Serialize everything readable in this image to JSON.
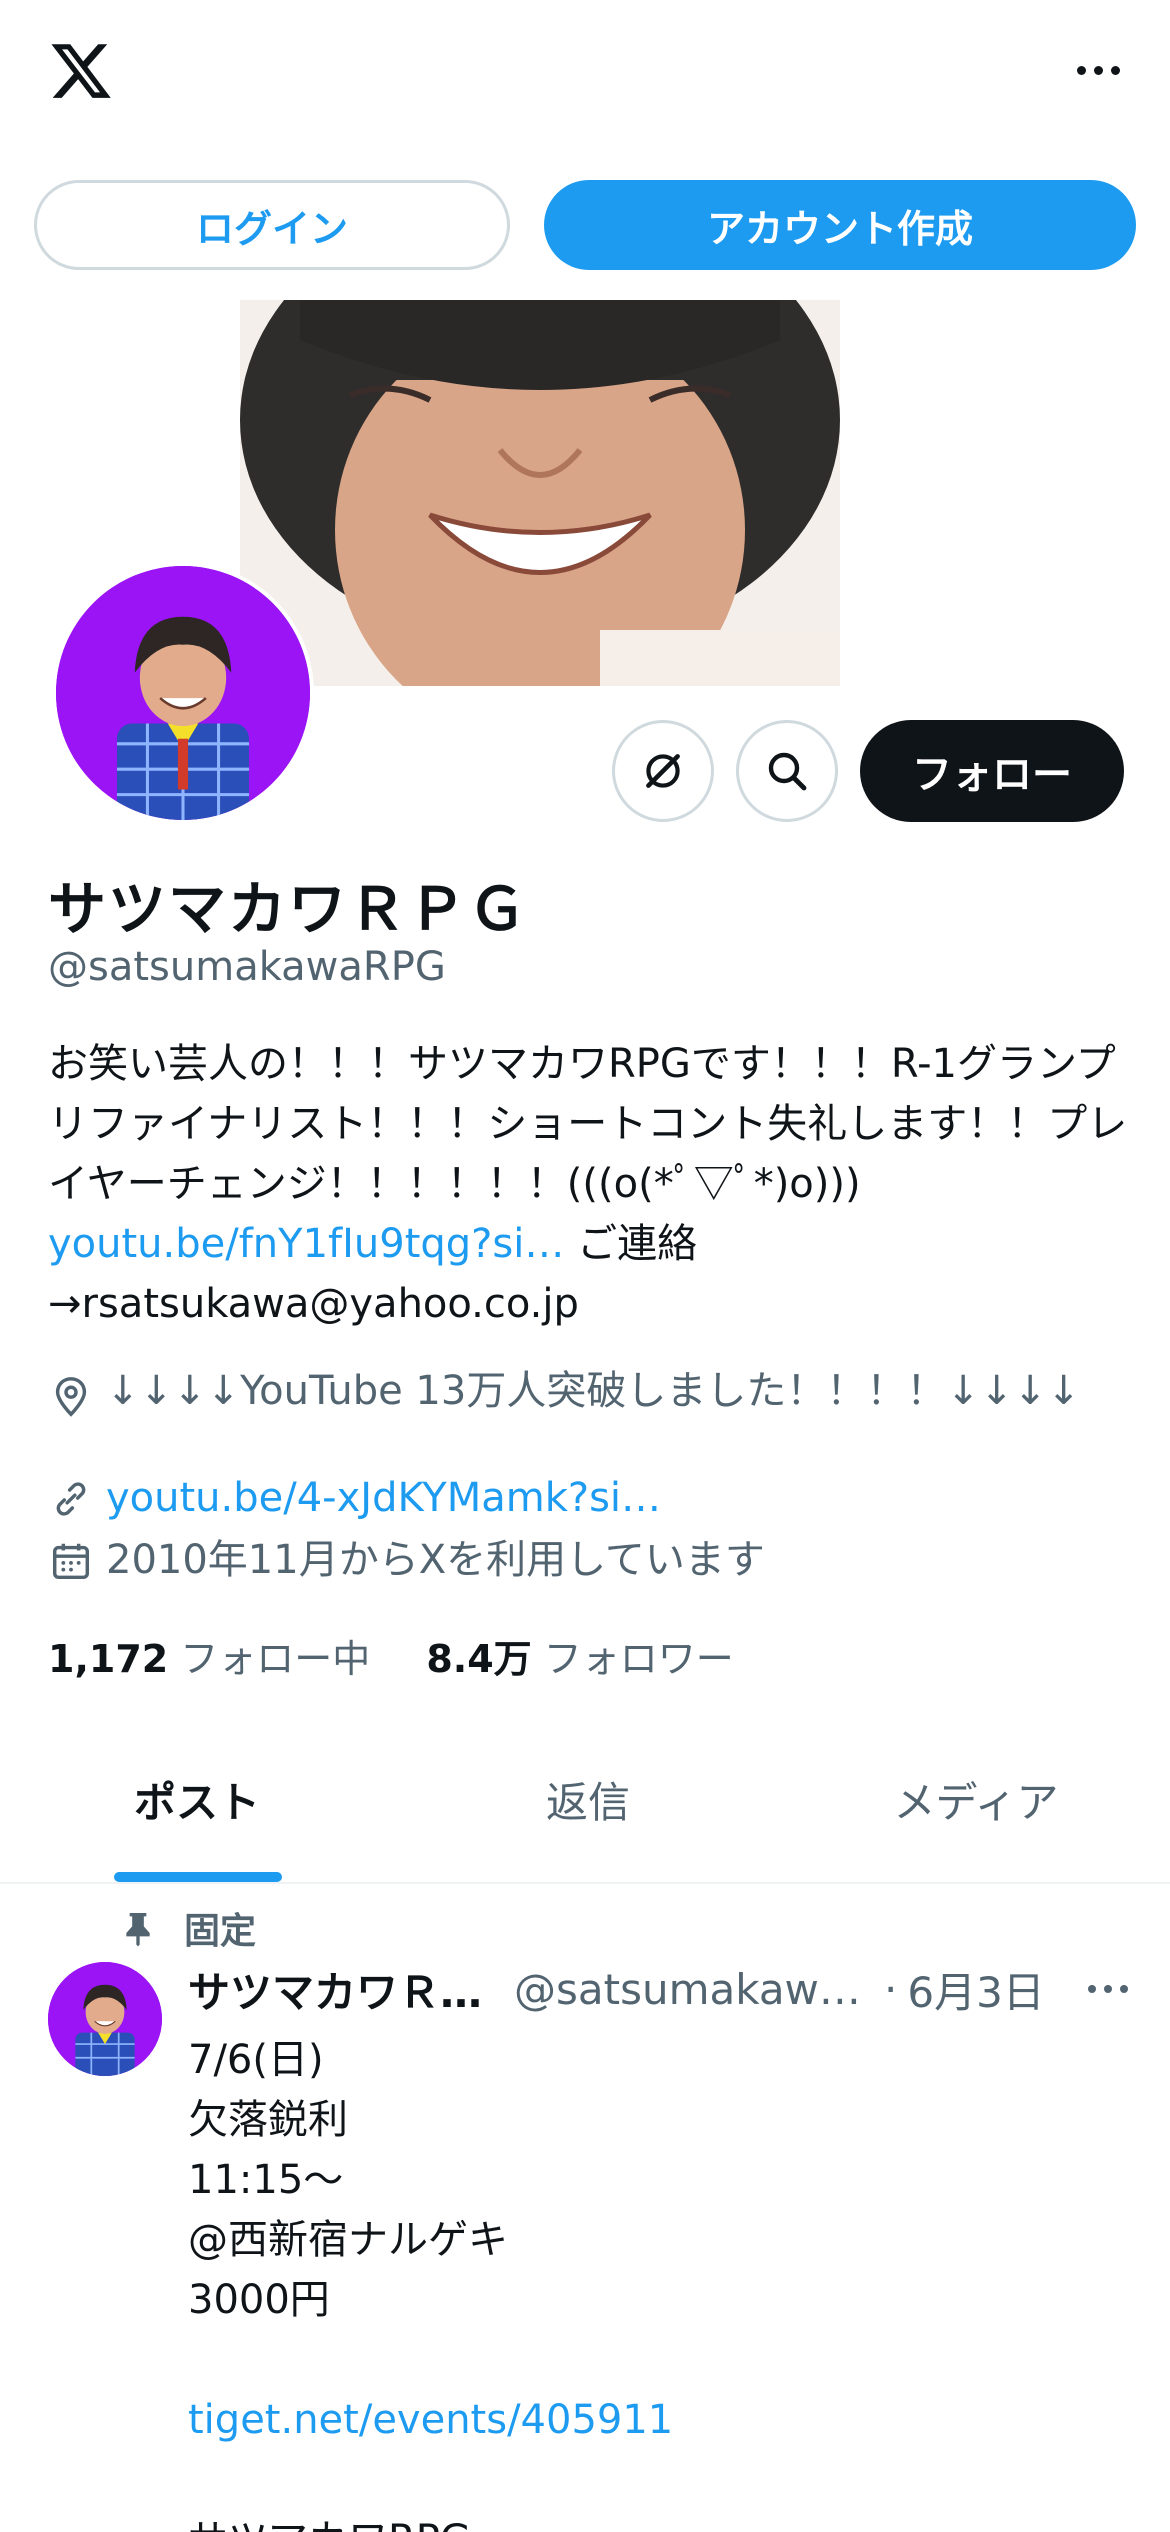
{
  "header": {
    "logo_icon": "x-logo-icon",
    "more_icon": "more-horizontal-icon"
  },
  "auth": {
    "login_label": "ログイン",
    "signup_label": "アカウント作成"
  },
  "profile": {
    "name": "サツマカワＲＰＧ",
    "handle": "@satsumakawaRPG",
    "bio_text": "お笑い芸人の！！！サツマカワRPGです！！！R-1グランプリファイナリスト！！！ショートコント失礼します！！プレイヤーチェンジ！！！！！！(((o(*ﾟ▽ﾟ*)o)))",
    "bio_link": "youtu.be/fnY1fIu9tqg?si…",
    "bio_contact_prefix": " ご連絡",
    "bio_contact": "→rsatsukawa@yahoo.co.jp",
    "location": "↓↓↓↓YouTube 13万人突破しました！！！！↓↓↓↓",
    "url": "youtu.be/4-xJdKYMamk?si…",
    "joined": "2010年11月からXを利用しています",
    "following_count": "1,172",
    "following_label": "フォロー中",
    "followers_count": "8.4万",
    "followers_label": "フォロワー",
    "follow_button": "フォロー",
    "accent_color": "#1d9bf0",
    "avatar_bg": "#9b14f5"
  },
  "tabs": [
    {
      "label": "ポスト",
      "active": true
    },
    {
      "label": "返信",
      "active": false
    },
    {
      "label": "メディア",
      "active": false
    }
  ],
  "post": {
    "pinned_label": "固定",
    "author_name": "サツマカワＲＰＧ",
    "author_handle": "@satsumakawaRPG",
    "date": "6月3日",
    "lines": [
      "7/6(日)",
      "欠落鋭利",
      "11:15〜",
      "@西新宿ナルゲキ",
      "3000円"
    ],
    "link": "tiget.net/events/405911",
    "trailing_line": "サツマカワRPG"
  }
}
